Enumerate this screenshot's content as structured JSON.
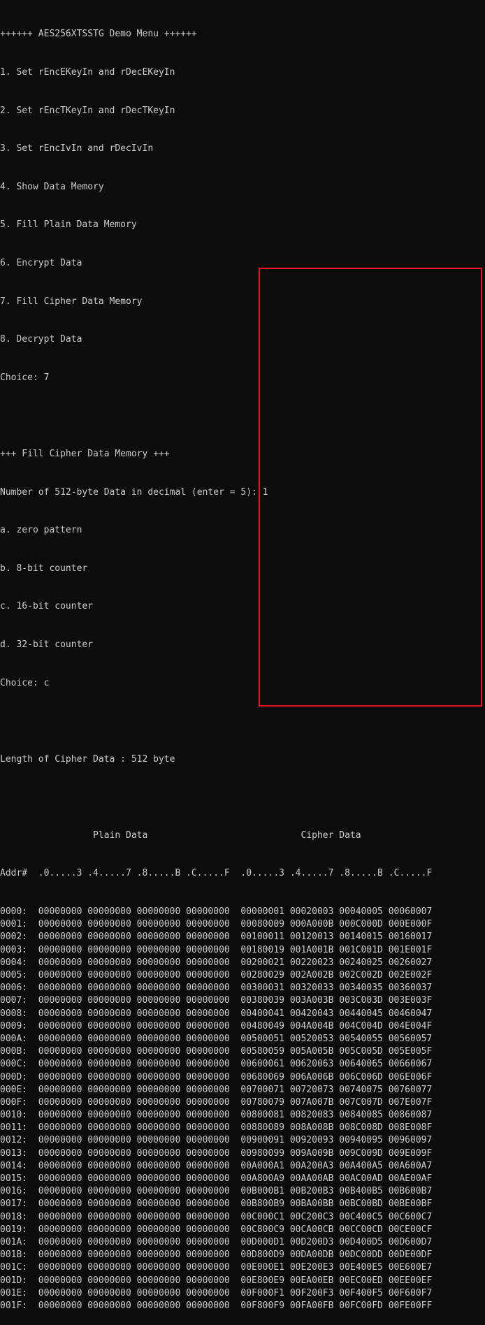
{
  "menu": {
    "title": "++++++ AES256XTSSTG Demo Menu ++++++",
    "items": [
      "1. Set rEncEKeyIn and rDecEKeyIn",
      "2. Set rEncTKeyIn and rDecTKeyIn",
      "3. Set rEncIvIn and rDecIvIn",
      "4. Show Data Memory",
      "5. Fill Plain Data Memory",
      "6. Encrypt Data",
      "7. Fill Cipher Data Memory",
      "8. Decrypt Data"
    ],
    "choice": "Choice: 7"
  },
  "fill": {
    "title": "+++ Fill Cipher Data Memory +++",
    "prompt": "Number of 512-byte Data in decimal (enter = 5): 1",
    "options": [
      "a. zero pattern",
      "b. 8-bit counter",
      "c. 16-bit counter",
      "d. 32-bit counter"
    ],
    "choice": "Choice: c"
  },
  "length_line": "Length of Cipher Data : 512 byte",
  "table": {
    "title_line": "                 Plain Data                            Cipher Data",
    "header_line": "Addr#  .0.....3 .4.....7 .8.....B .C.....F  .0.....3 .4.....7 .8.....B .C.....F",
    "rows": [
      "0000:  00000000 00000000 00000000 00000000  00000001 00020003 00040005 00060007",
      "0001:  00000000 00000000 00000000 00000000  00080009 000A000B 000C000D 000E000F",
      "0002:  00000000 00000000 00000000 00000000  00100011 00120013 00140015 00160017",
      "0003:  00000000 00000000 00000000 00000000  00180019 001A001B 001C001D 001E001F",
      "0004:  00000000 00000000 00000000 00000000  00200021 00220023 00240025 00260027",
      "0005:  00000000 00000000 00000000 00000000  00280029 002A002B 002C002D 002E002F",
      "0006:  00000000 00000000 00000000 00000000  00300031 00320033 00340035 00360037",
      "0007:  00000000 00000000 00000000 00000000  00380039 003A003B 003C003D 003E003F",
      "0008:  00000000 00000000 00000000 00000000  00400041 00420043 00440045 00460047",
      "0009:  00000000 00000000 00000000 00000000  00480049 004A004B 004C004D 004E004F",
      "000A:  00000000 00000000 00000000 00000000  00500051 00520053 00540055 00560057",
      "000B:  00000000 00000000 00000000 00000000  00580059 005A005B 005C005D 005E005F",
      "000C:  00000000 00000000 00000000 00000000  00600061 00620063 00640065 00660067",
      "000D:  00000000 00000000 00000000 00000000  00680069 006A006B 006C006D 006E006F",
      "000E:  00000000 00000000 00000000 00000000  00700071 00720073 00740075 00760077",
      "000F:  00000000 00000000 00000000 00000000  00780079 007A007B 007C007D 007E007F",
      "0010:  00000000 00000000 00000000 00000000  00800081 00820083 00840085 00860087",
      "0011:  00000000 00000000 00000000 00000000  00880089 008A008B 008C008D 008E008F",
      "0012:  00000000 00000000 00000000 00000000  00900091 00920093 00940095 00960097",
      "0013:  00000000 00000000 00000000 00000000  00980099 009A009B 009C009D 009E009F",
      "0014:  00000000 00000000 00000000 00000000  00A000A1 00A200A3 00A400A5 00A600A7",
      "0015:  00000000 00000000 00000000 00000000  00A800A9 00AA00AB 00AC00AD 00AE00AF",
      "0016:  00000000 00000000 00000000 00000000  00B000B1 00B200B3 00B400B5 00B600B7",
      "0017:  00000000 00000000 00000000 00000000  00B800B9 00BA00BB 00BC00BD 00BE00BF",
      "0018:  00000000 00000000 00000000 00000000  00C000C1 00C200C3 00C400C5 00C600C7",
      "0019:  00000000 00000000 00000000 00000000  00C800C9 00CA00CB 00CC00CD 00CE00CF",
      "001A:  00000000 00000000 00000000 00000000  00D000D1 00D200D3 00D400D5 00D600D7",
      "001B:  00000000 00000000 00000000 00000000  00D800D9 00DA00DB 00DC00DD 00DE00DF",
      "001C:  00000000 00000000 00000000 00000000  00E000E1 00E200E3 00E400E5 00E600E7",
      "001D:  00000000 00000000 00000000 00000000  00E800E9 00EA00EB 00EC00ED 00EE00EF",
      "001E:  00000000 00000000 00000000 00000000  00F000F1 00F200F3 00F400F5 00F600F7",
      "001F:  00000000 00000000 00000000 00000000  00F800F9 00FA00FB 00FC00FD 00FE00FF"
    ]
  },
  "colors": {
    "background": "#0c0c0c",
    "text": "#cccccc",
    "highlight_border": "#e8141f"
  }
}
